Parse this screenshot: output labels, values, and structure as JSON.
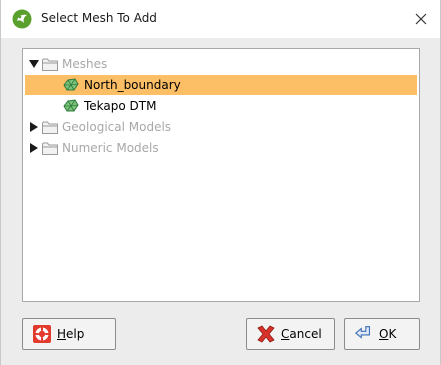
{
  "window": {
    "title": "Select Mesh To Add",
    "app_icon": "leapfrog-app-icon",
    "close_icon": "close-icon"
  },
  "tree": {
    "selected": "North_boundary",
    "nodes": [
      {
        "label": "Meshes",
        "expanded": true,
        "icon": "folder-icon"
      },
      {
        "label": "North_boundary",
        "icon": "mesh-icon",
        "selected": true
      },
      {
        "label": "Tekapo DTM",
        "icon": "mesh-icon"
      },
      {
        "label": "Geological Models",
        "expanded": false,
        "icon": "folder-icon"
      },
      {
        "label": "Numeric Models",
        "expanded": false,
        "icon": "folder-icon"
      }
    ]
  },
  "buttons": {
    "help": {
      "mnemonic": "H",
      "rest": "elp",
      "icon": "lifebuoy-icon"
    },
    "cancel": {
      "mnemonic": "C",
      "rest": "ancel",
      "icon": "cancel-x-icon"
    },
    "ok": {
      "mnemonic": "O",
      "rest": "K",
      "icon": "ok-arrow-icon"
    }
  },
  "colors": {
    "selection": "#fcbf66",
    "dialog_bg": "#ececec",
    "disabled_text": "#a8a8a8"
  }
}
